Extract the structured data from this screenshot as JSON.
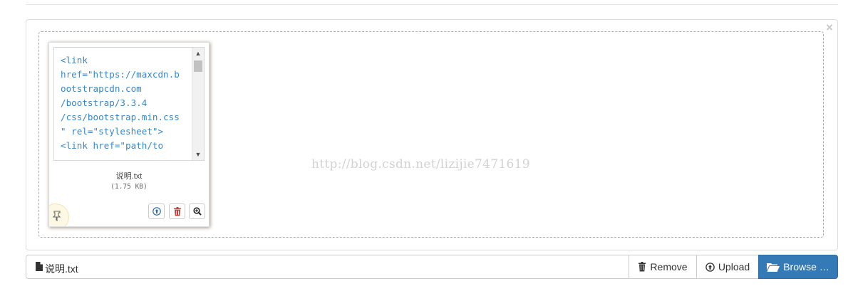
{
  "watermark": "http://blog.csdn.net/lizijie7471619",
  "preview": {
    "text_lines": [
      "<link",
      "href=\"https://maxcdn.b",
      "ootstrapcdn.com",
      "/bootstrap/3.3.4",
      "/css/bootstrap.min.css",
      "\" rel=\"stylesheet\">",
      "<link href=\"path/to"
    ],
    "file_name": "说明.txt",
    "file_size": "(1.75 KB)"
  },
  "caption": {
    "file_name": "说明.txt"
  },
  "buttons": {
    "remove": "Remove",
    "upload": "Upload",
    "browse": "Browse …"
  },
  "icons": {
    "close": "close-icon",
    "drag": "drag-handle-icon",
    "thumb_upload": "upload-circle-icon",
    "thumb_remove": "trash-icon",
    "thumb_zoom": "zoom-in-icon",
    "caption_file": "file-icon",
    "remove": "trash-icon",
    "upload": "upload-circle-icon",
    "browse": "folder-open-icon"
  },
  "colors": {
    "primary": "#337ab7",
    "code_text": "#3a86c6",
    "drag_handle_bg": "#fcf8e3"
  }
}
